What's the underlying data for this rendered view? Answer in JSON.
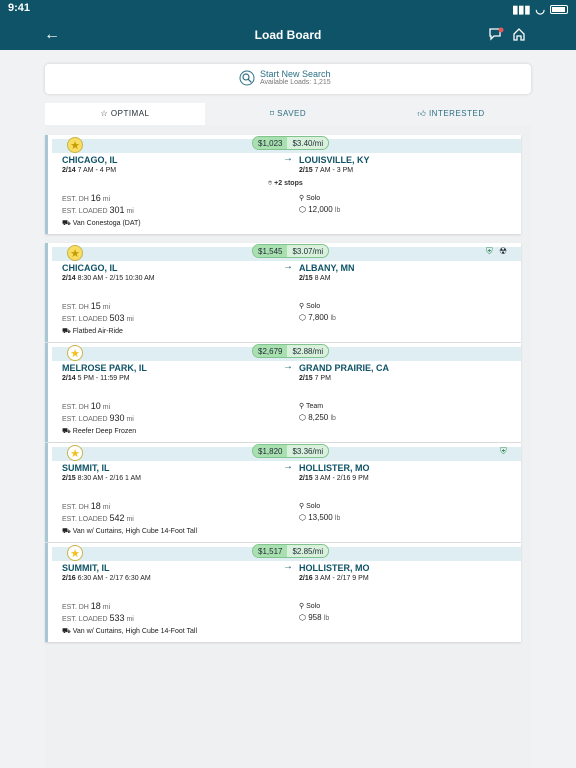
{
  "status": {
    "time": "9:41"
  },
  "header": {
    "title": "Load Board"
  },
  "search": {
    "title": "Start New Search",
    "sub": "Available Loads: 1,215"
  },
  "tabs": [
    "☆ OPTIMAL",
    "SAVED",
    "INTERESTED"
  ],
  "cards": [
    {
      "star": "filled",
      "price": "$1,023",
      "rate": "$3.40/mi",
      "from": "CHICAGO, IL",
      "from_time_a": "2/14",
      "from_time_b": " 7 AM - 4 PM",
      "to": "LOUISVILLE, KY",
      "to_time_a": "2/15",
      "to_time_b": " 7 AM - 3 PM",
      "stops": "+2 stops",
      "dh": "16",
      "loaded": "301",
      "driver": "Solo",
      "weight": "12,000",
      "equip": "Van Conestoga (DAT)"
    },
    {
      "star": "filled",
      "price": "$1,545",
      "rate": "$3.07/mi",
      "from": "CHICAGO, IL",
      "from_time_a": "2/14",
      "from_time_b": " 8:30 AM - 2/15 10:30 AM",
      "to": "ALBANY, MN",
      "to_time_a": "2/15",
      "to_time_b": " 8 AM",
      "stops": "",
      "dh": "15",
      "loaded": "503",
      "driver": "Solo",
      "weight": "7,800",
      "equip": "Flatbed Air-Ride"
    },
    {
      "star": "outline",
      "price": "$2,679",
      "rate": "$2.88/mi",
      "from": "MELROSE PARK, IL",
      "from_time_a": "2/14",
      "from_time_b": " 5 PM - 11:59 PM",
      "to": "GRAND PRAIRIE, CA",
      "to_time_a": "2/15",
      "to_time_b": " 7 PM",
      "stops": "",
      "dh": "10",
      "loaded": "930",
      "driver": "Team",
      "weight": "8,250",
      "equip": "Reefer Deep Frozen"
    },
    {
      "star": "outline",
      "price": "$1,820",
      "rate": "$3.36/mi",
      "from": "SUMMIT, IL",
      "from_time_a": "2/15",
      "from_time_b": " 8:30 AM - 2/16 1 AM",
      "to": "HOLLISTER, MO",
      "to_time_a": "2/15",
      "to_time_b": " 3 AM - 2/16 9 PM",
      "stops": "",
      "dh": "18",
      "loaded": "542",
      "driver": "Solo",
      "weight": "13,500",
      "equip": "Van w/ Curtains, High Cube 14-Foot Tall"
    },
    {
      "star": "outline",
      "price": "$1,517",
      "rate": "$2.85/mi",
      "from": "SUMMIT, IL",
      "from_time_a": "2/16",
      "from_time_b": " 6:30 AM - 2/17 6:30 AM",
      "to": "HOLLISTER, MO",
      "to_time_a": "2/16",
      "to_time_b": " 3 AM - 2/17 9 PM",
      "stops": "",
      "dh": "18",
      "loaded": "533",
      "driver": "Solo",
      "weight": "958",
      "equip": "Van w/ Curtains, High Cube 14-Foot Tall"
    }
  ],
  "labels": {
    "dh": "EST. DH",
    "loaded": "EST. LOADED",
    "mi": "mi",
    "lb": "lb"
  }
}
